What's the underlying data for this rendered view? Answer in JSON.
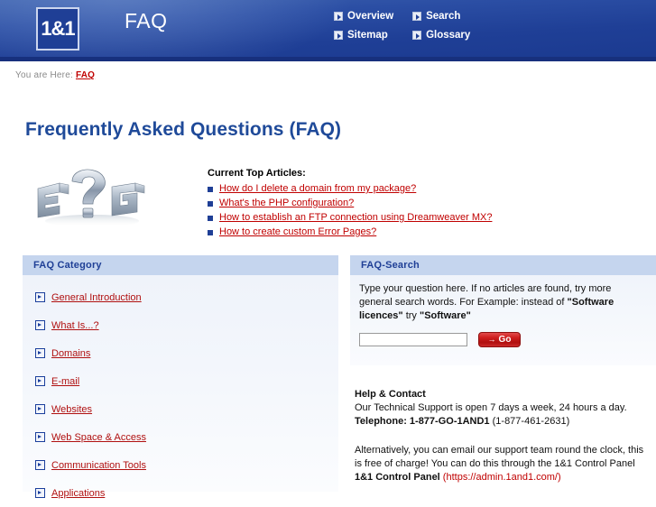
{
  "header": {
    "logo_text": "1&1",
    "title": "FAQ",
    "nav": [
      {
        "label": "Overview",
        "icon": "arrow-right-icon"
      },
      {
        "label": "Search",
        "icon": "arrow-right-icon"
      },
      {
        "label": "Sitemap",
        "icon": "arrow-right-icon"
      },
      {
        "label": "Glossary",
        "icon": "arrow-right-icon"
      }
    ]
  },
  "breadcrumb": {
    "prefix": "You are Here:",
    "current": "FAQ"
  },
  "page_title": "Frequently Asked Questions (FAQ)",
  "top_articles": {
    "heading": "Current Top Articles:",
    "items": [
      "How do I delete a domain from my package?",
      "What's the PHP configuration?",
      "How to establish an FTP connection using Dreamweaver MX?",
      "How to create custom Error Pages?"
    ]
  },
  "faq_category": {
    "panel_title": "FAQ Category",
    "items": [
      "General Introduction",
      "What Is...?",
      "Domains",
      "E-mail",
      "Websites",
      "Web Space & Access",
      "Communication Tools",
      "Applications"
    ]
  },
  "faq_search": {
    "panel_title": "FAQ-Search",
    "description_part1": "Type your question here. If no articles are found, try more general search words. For Example: instead of ",
    "description_bold1": "\"Software licences\"",
    "description_part2": " try ",
    "description_bold2": "\"Software\"",
    "input_value": "",
    "input_placeholder": "",
    "go_label": "Go",
    "go_arrow": "→"
  },
  "help_contact": {
    "title": "Help & Contact",
    "hours": "Our Technical Support is open 7 days a week, 24 hours a day.",
    "telephone_label": "Telephone: 1-877-GO-1AND1",
    "telephone_alt": " (1-877-461-2631)",
    "alt_line1": "Alternatively, you can email our support team round the clock, this",
    "alt_line2": "is free of charge! You can do this through the 1&1 Control Panel",
    "cp_label": "1&1 Control Panel",
    "cp_url": " (https://admin.1and1.com/)"
  },
  "colors": {
    "header_blue": "#1f3f96",
    "accent_red": "#c00000",
    "panel_header": "#c5d5ee",
    "title_blue": "#1f4a99"
  }
}
